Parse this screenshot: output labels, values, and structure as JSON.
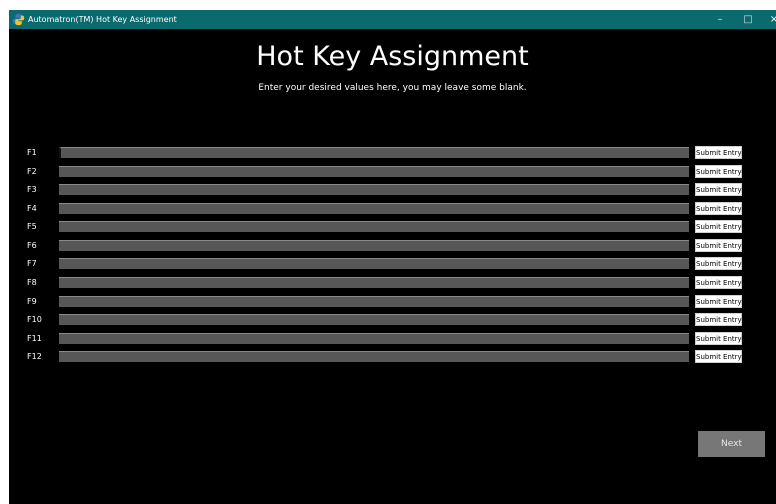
{
  "window": {
    "title": "Automatron(TM) Hot Key Assignment",
    "controls": {
      "minimize": "–",
      "maximize": "□",
      "close": "×"
    }
  },
  "page": {
    "heading": "Hot Key Assignment",
    "subheading": "Enter your desired values here, you may leave some blank."
  },
  "hotkeys": [
    {
      "label": "F1",
      "value": "",
      "submit_label": "Submit Entry"
    },
    {
      "label": "F2",
      "value": "",
      "submit_label": "Submit Entry"
    },
    {
      "label": "F3",
      "value": "",
      "submit_label": "Submit Entry"
    },
    {
      "label": "F4",
      "value": "",
      "submit_label": "Submit Entry"
    },
    {
      "label": "F5",
      "value": "",
      "submit_label": "Submit Entry"
    },
    {
      "label": "F6",
      "value": "",
      "submit_label": "Submit Entry"
    },
    {
      "label": "F7",
      "value": "",
      "submit_label": "Submit Entry"
    },
    {
      "label": "F8",
      "value": "",
      "submit_label": "Submit Entry"
    },
    {
      "label": "F9",
      "value": "",
      "submit_label": "Submit Entry"
    },
    {
      "label": "F10",
      "value": "",
      "submit_label": "Submit Entry"
    },
    {
      "label": "F11",
      "value": "",
      "submit_label": "Submit Entry"
    },
    {
      "label": "F12",
      "value": "",
      "submit_label": "Submit Entry"
    }
  ],
  "footer": {
    "next_label": "Next"
  },
  "colors": {
    "titlebar": "#0a6a6e",
    "background": "#000000",
    "entry_field": "#575757",
    "next_button": "#777777"
  },
  "icons": {
    "app": "python-icon"
  }
}
